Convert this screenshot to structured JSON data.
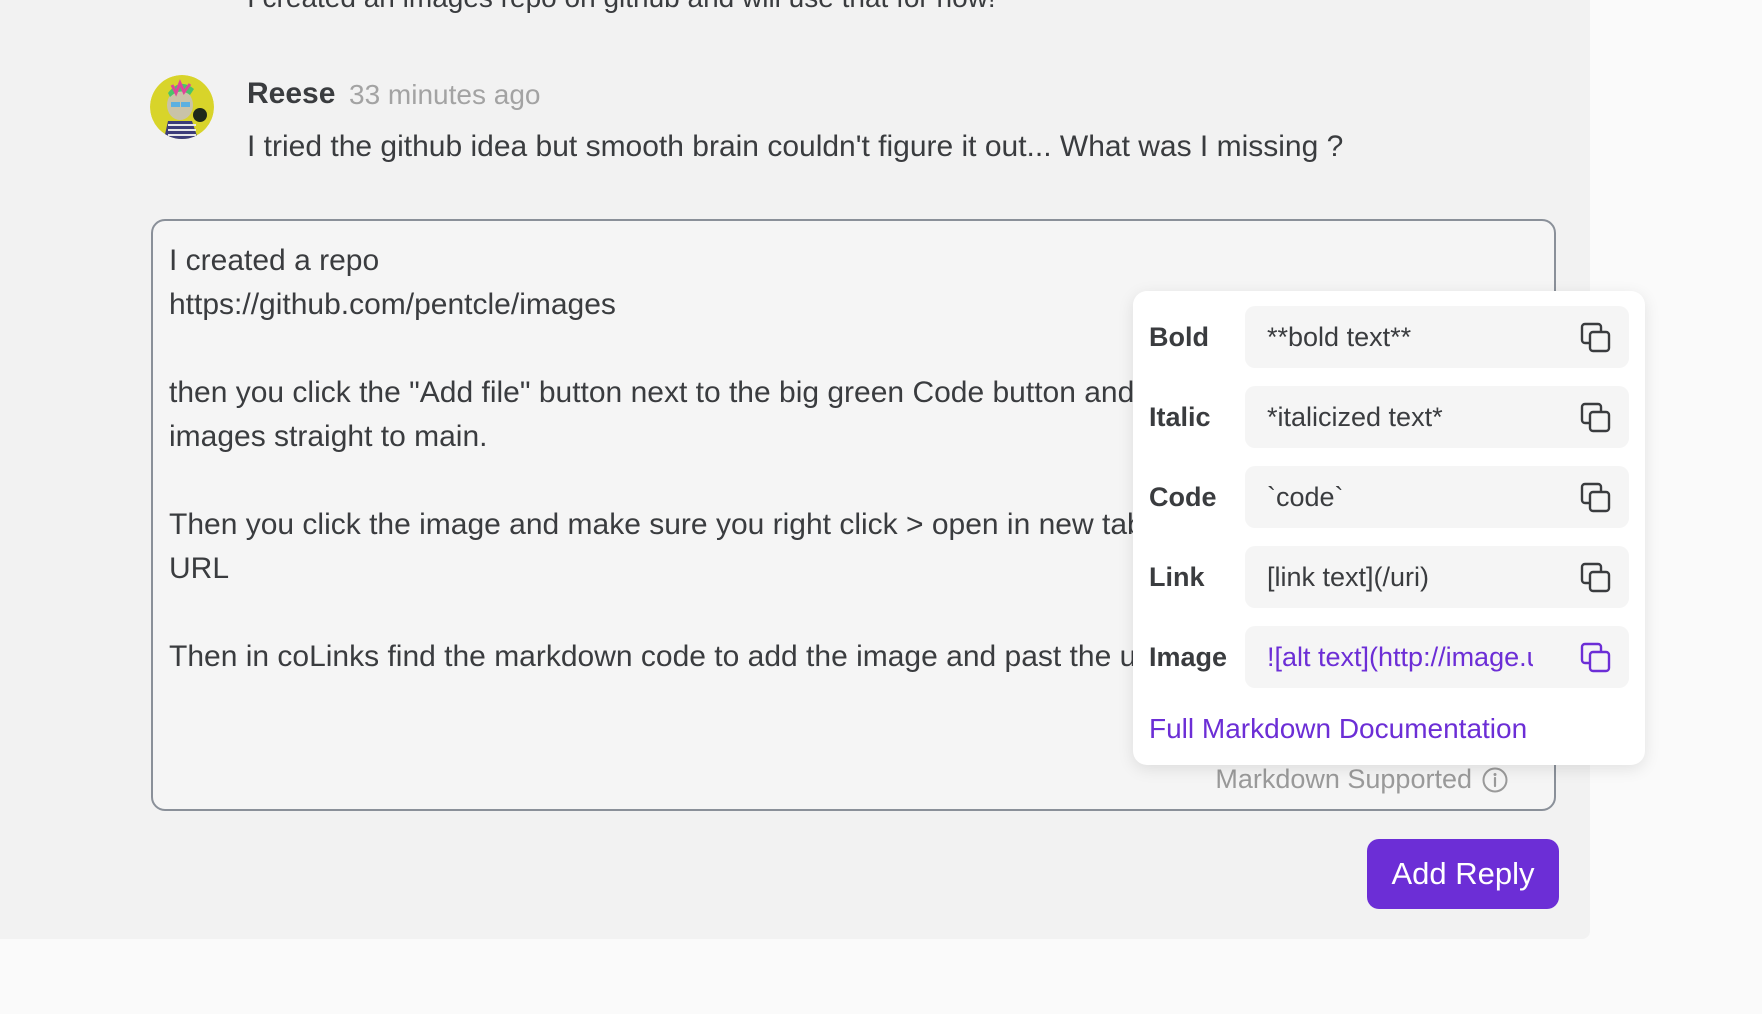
{
  "thread": {
    "previous_comment_text": "I created an images repo on github and will use that for now!",
    "comment": {
      "author": "Reese",
      "time": "33 minutes ago",
      "text": "I tried the github idea but smooth brain couldn't figure it out... What was I missing ?"
    }
  },
  "editor": {
    "value": "I created a repo\nhttps://github.com/pentcle/images\n\nthen you click the \"Add file\" button next to the big green Code button and upload\nimages straight to main.\n\nThen you click the image and make sure you right click > open in new tab to get the\nURL\n\nThen in coLinks find the markdown code to add the image and past the url",
    "markdown_hint": "Markdown Supported"
  },
  "markdown_help": {
    "rows": [
      {
        "label": "Bold",
        "example": "**bold text**"
      },
      {
        "label": "Italic",
        "example": "*italicized text*"
      },
      {
        "label": "Code",
        "example": "`code`"
      },
      {
        "label": "Link",
        "example": "[link text](/uri)"
      },
      {
        "label": "Image",
        "example": "![alt text](http://image.url)"
      }
    ],
    "doc_link": "Full Markdown Documentation"
  },
  "actions": {
    "reply_label": "Add Reply"
  },
  "colors": {
    "accent": "#6c2ed6",
    "panel_bg": "#f2f2f2",
    "text": "#3a3c3f",
    "muted": "#a3a3a3"
  },
  "icons": {
    "copy": "copy-icon",
    "info": "info-icon"
  }
}
